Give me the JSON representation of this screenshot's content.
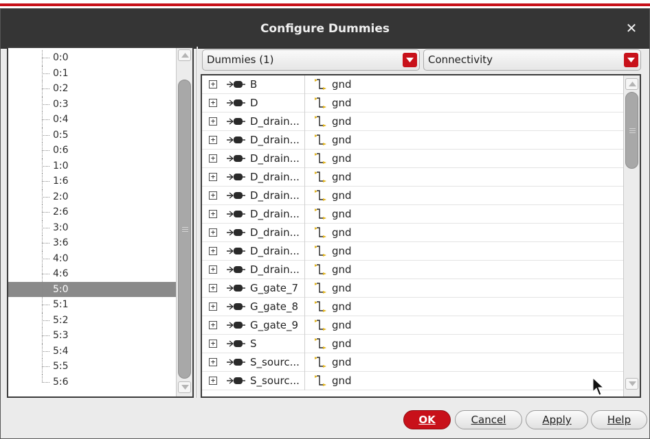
{
  "dialog": {
    "title": "Configure Dummies",
    "close_icon": "close-icon"
  },
  "tree": {
    "items": [
      "0:0",
      "0:1",
      "0:2",
      "0:3",
      "0:4",
      "0:5",
      "0:6",
      "1:0",
      "1:6",
      "2:0",
      "2:6",
      "3:0",
      "3:6",
      "4:0",
      "4:6",
      "5:0",
      "5:1",
      "5:2",
      "5:3",
      "5:4",
      "5:5",
      "5:6"
    ],
    "selected": "5:0"
  },
  "toolbar": {
    "dummies_combo": "Dummies (1)",
    "view_combo": "Connectivity"
  },
  "table": {
    "rows": [
      {
        "terminal": "B",
        "net": "gnd"
      },
      {
        "terminal": "D",
        "net": "gnd"
      },
      {
        "terminal": "D_drain...",
        "net": "gnd"
      },
      {
        "terminal": "D_drain...",
        "net": "gnd"
      },
      {
        "terminal": "D_drain...",
        "net": "gnd"
      },
      {
        "terminal": "D_drain...",
        "net": "gnd"
      },
      {
        "terminal": "D_drain...",
        "net": "gnd"
      },
      {
        "terminal": "D_drain...",
        "net": "gnd"
      },
      {
        "terminal": "D_drain...",
        "net": "gnd"
      },
      {
        "terminal": "D_drain...",
        "net": "gnd"
      },
      {
        "terminal": "D_drain...",
        "net": "gnd"
      },
      {
        "terminal": "G_gate_7",
        "net": "gnd"
      },
      {
        "terminal": "G_gate_8",
        "net": "gnd"
      },
      {
        "terminal": "G_gate_9",
        "net": "gnd"
      },
      {
        "terminal": "S",
        "net": "gnd"
      },
      {
        "terminal": "S_sourc...",
        "net": "gnd"
      },
      {
        "terminal": "S_sourc...",
        "net": "gnd"
      }
    ],
    "expand_glyph": "+"
  },
  "footer": {
    "ok": "OK",
    "cancel": "Cancel",
    "apply": "Apply",
    "help": "Help"
  },
  "colors": {
    "accent": "#c8111a",
    "titlebar": "#353535",
    "selected_row": "#8a8a8a",
    "net_icon": "#e0b21a"
  }
}
